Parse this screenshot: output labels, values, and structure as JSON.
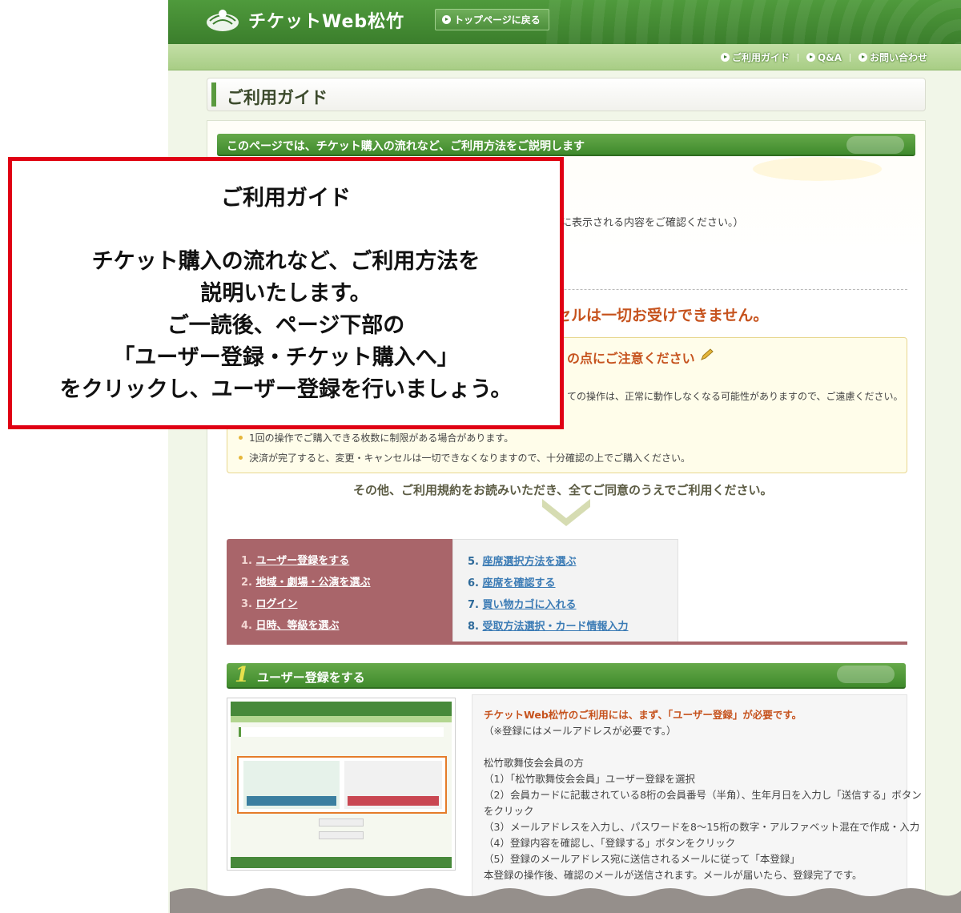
{
  "header": {
    "logo_text": "チケットWeb松竹",
    "top_button": "トップページに戻る"
  },
  "subnav": {
    "items": [
      "ご利用ガイド",
      "Q&A",
      "お問い合わせ"
    ]
  },
  "page": {
    "title": "ご利用ガイド",
    "intro": "このページでは、チケット購入の流れなど、ご利用方法をご説明します",
    "body_fragment": "に表示される内容をご確認ください。）",
    "warning_fragment": "ンセルは一切お受けできません。",
    "notice": {
      "title_fragment": "の点にご注意ください",
      "text_fragment": "ての操作は、正常に動作しなくなる可能性がありますので、ご遠慮ください。",
      "items": [
        "1回の操作でご購入できる枚数に制限がある場合があります。",
        "決済が完了すると、変更・キャンセルは一切できなくなりますので、十分確認の上でご購入ください。"
      ]
    },
    "agree_text": "その他、ご利用規約をお読みいただき、全てご同意のうえでご利用ください。"
  },
  "steps": [
    {
      "num": "1.",
      "label": "ユーザー登録をする"
    },
    {
      "num": "2.",
      "label": "地域・劇場・公演を選ぶ"
    },
    {
      "num": "3.",
      "label": "ログイン"
    },
    {
      "num": "4.",
      "label": "日時、等級を選ぶ"
    },
    {
      "num": "5.",
      "label": "座席選択方法を選ぶ"
    },
    {
      "num": "6.",
      "label": "座席を確認する"
    },
    {
      "num": "7.",
      "label": "買い物カゴに入れる"
    },
    {
      "num": "8.",
      "label": "受取方法選択・カード情報入力"
    }
  ],
  "section1": {
    "num": "1",
    "title": "ユーザー登録をする",
    "lines": [
      "チケットWeb松竹のご利用には、まず、「ユーザー登録」が必要です。",
      "（※登録にはメールアドレスが必要です。）",
      "",
      "松竹歌舞伎会会員の方",
      "（1）「松竹歌舞伎会会員」ユーザー登録を選択",
      "（2）会員カードに記載されている8桁の会員番号（半角）、生年月日を入力し「送信する」ボタン",
      "をクリック",
      "（3）メールアドレスを入力し、パスワードを8〜15桁の数字・アルファベット混在で作成・入力",
      "（4）登録内容を確認し、「登録する」ボタンをクリック",
      "（5）登録のメールアドレス宛に送信されるメールに従って「本登録」",
      "本登録の操作後、確認のメールが送信されます。メールが届いたら、登録完了です。"
    ]
  },
  "callout": {
    "title": "ご利用ガイド",
    "lines": [
      "チケット購入の流れなど、ご利用方法を",
      "説明いたします。",
      "ご一読後、ページ下部の",
      "「ユーザー登録・チケット購入へ」",
      "をクリックし、ユーザー登録を行いましょう。"
    ]
  },
  "colors": {
    "header_green": "#3b7e2c",
    "callout_border": "#e00014",
    "warning_orange": "#c6531e",
    "steps_left": "#a9656a"
  }
}
